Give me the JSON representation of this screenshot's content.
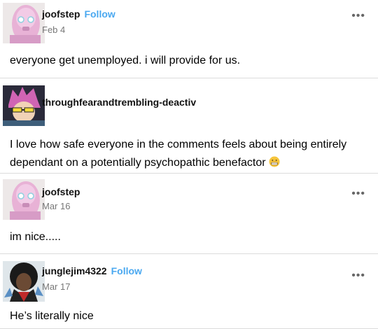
{
  "posts": [
    {
      "username": "joofstep",
      "follow_label": "Follow",
      "date": "Feb 4",
      "text": "everyone get unemployed. i will provide for us.",
      "more_label": "•••",
      "avatar_icon": "pink-armored-character-avatar"
    },
    {
      "username": "throughfearandtrembling-deactiv",
      "text": "I love how safe everyone in the comments feels about being entirely dependant on a potentially psychopathic benefactor",
      "emoji": "grimacing-face",
      "avatar_icon": "pink-hair-glasses-avatar"
    },
    {
      "username": "joofstep",
      "date": "Mar 16",
      "text": "im nice.....",
      "more_label": "•••",
      "avatar_icon": "pink-armored-character-avatar"
    },
    {
      "username": "junglejim4322",
      "follow_label": "Follow",
      "date": "Mar 17",
      "text": "He’s literally nice",
      "more_label": "•••",
      "avatar_icon": "afro-hero-avatar"
    }
  ],
  "colors": {
    "follow": "#4aa8f0",
    "divider": "#dcdcdc",
    "text": "#000000",
    "muted": "#777777"
  }
}
